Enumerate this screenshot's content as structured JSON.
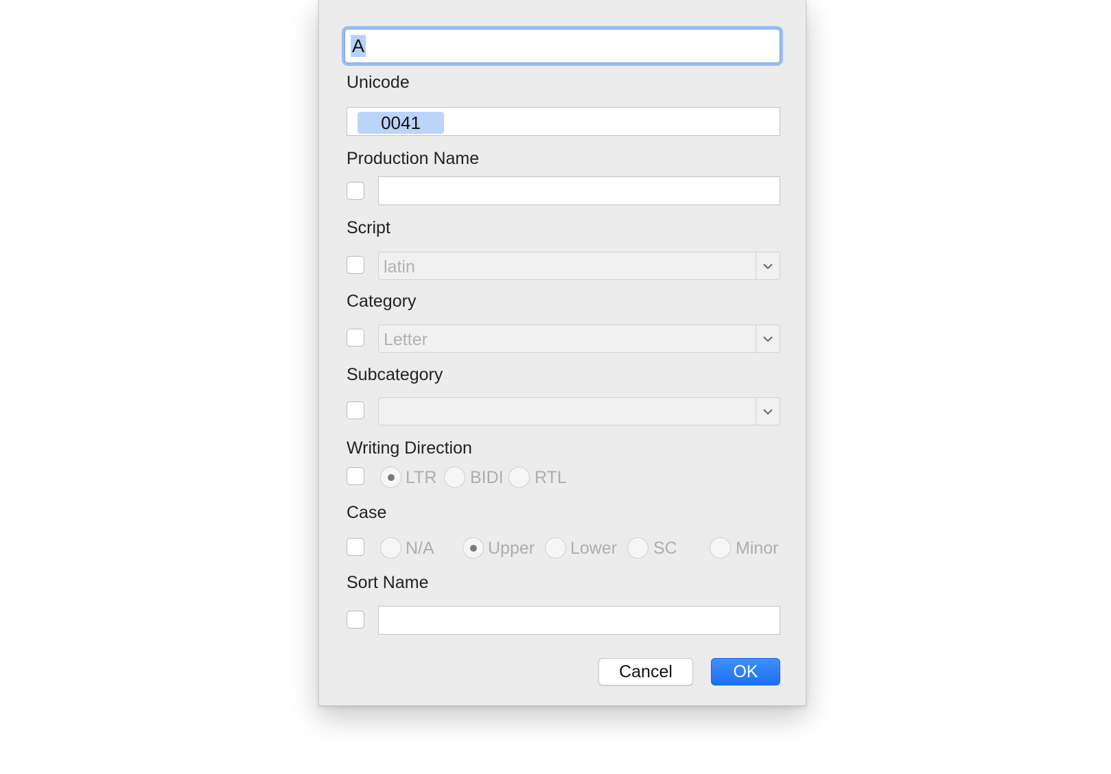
{
  "dialog": {
    "glyph_name": "A",
    "unicode": {
      "label": "Unicode",
      "value": "0041"
    },
    "production_name": {
      "label": "Production Name",
      "value": ""
    },
    "script": {
      "label": "Script",
      "value": "latin"
    },
    "category": {
      "label": "Category",
      "value": "Letter"
    },
    "subcategory": {
      "label": "Subcategory",
      "value": ""
    },
    "writing_direction": {
      "label": "Writing Direction",
      "options": [
        "LTR",
        "BIDI",
        "RTL"
      ],
      "selected": "LTR"
    },
    "case": {
      "label": "Case",
      "options": [
        "N/A",
        "Upper",
        "Lower",
        "SC",
        "Minor"
      ],
      "selected": "Upper"
    },
    "sort_name": {
      "label": "Sort Name",
      "value": ""
    },
    "buttons": {
      "cancel": "Cancel",
      "ok": "OK"
    }
  },
  "colors": {
    "accent": "#1b70f2",
    "focus_ring": "#9bbcf5",
    "selection": "#bcd4f8"
  },
  "icons": [
    "chevron-down-icon",
    "radio-dot"
  ]
}
